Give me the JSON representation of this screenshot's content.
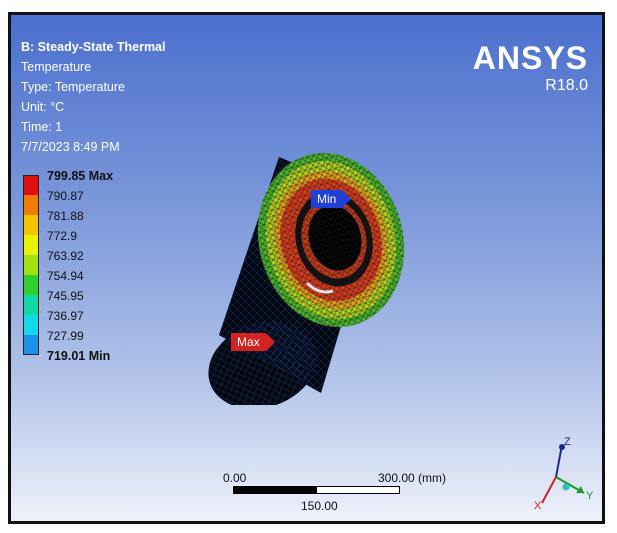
{
  "header": {
    "title": "B: Steady-State Thermal",
    "result": "Temperature",
    "type": "Type: Temperature",
    "unit": "Unit: °C",
    "time": "Time: 1",
    "datetime": "7/7/2023 8:49 PM"
  },
  "brand": {
    "name": "ANSYS",
    "version": "R18.0"
  },
  "legend": {
    "labels": [
      "799.85 Max",
      "790.87",
      "781.88",
      "772.9",
      "763.92",
      "754.94",
      "745.95",
      "736.97",
      "727.99",
      "719.01 Min"
    ],
    "colors": [
      "#e01010",
      "#f27a00",
      "#f5c400",
      "#eaf200",
      "#a2e012",
      "#2ed02e",
      "#12d8a6",
      "#12d8ee",
      "#1a93e8",
      "#1a26e0"
    ]
  },
  "probes": {
    "min_label": "Min",
    "max_label": "Max"
  },
  "scale": {
    "left": "0.00",
    "right": "300.00 (mm)",
    "mid": "150.00"
  },
  "triad": {
    "z": "Z",
    "y": "Y",
    "x": "X"
  }
}
